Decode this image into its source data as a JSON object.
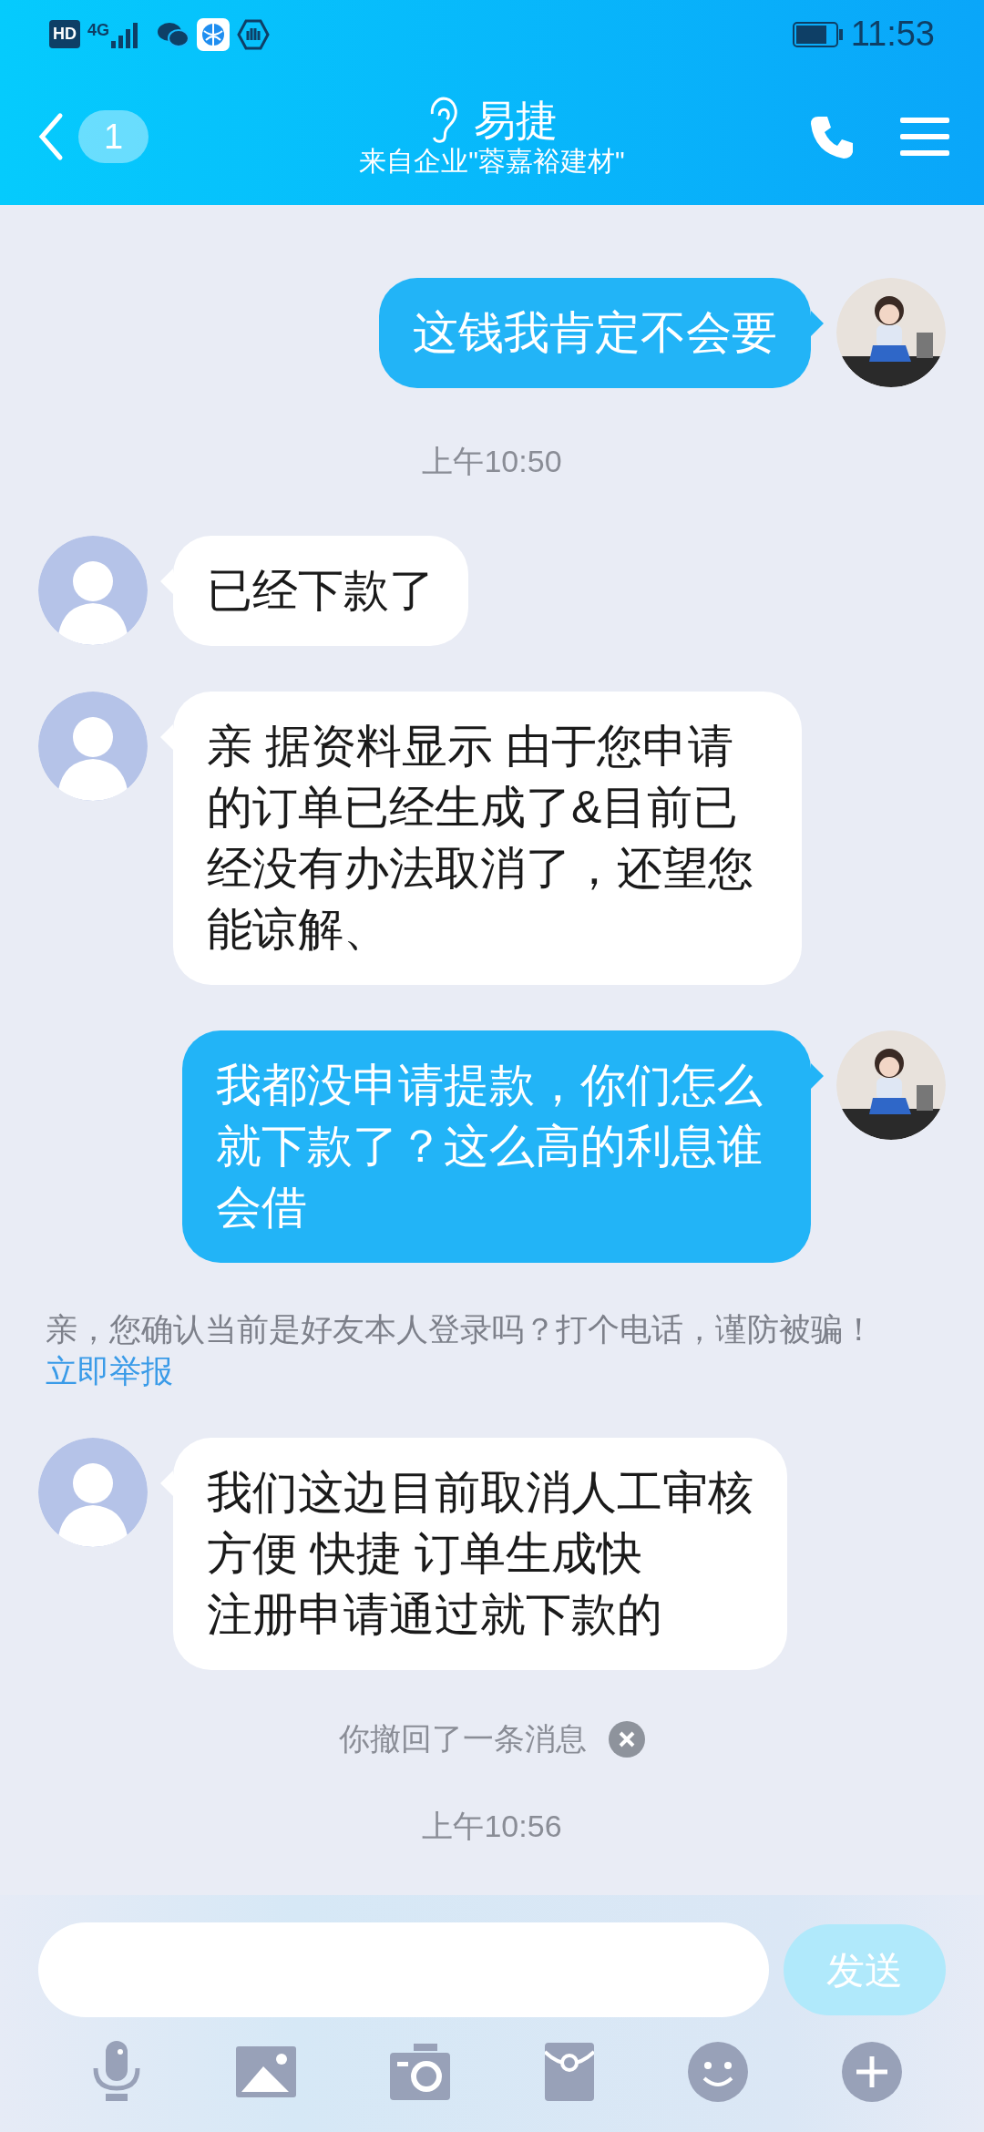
{
  "status_bar": {
    "hd": "HD",
    "network": "4G",
    "time": "11:53"
  },
  "header": {
    "back_count": "1",
    "title": "易捷",
    "subtitle": "来自企业\"蓉嘉裕建材\""
  },
  "messages": [
    {
      "kind": "outgoing",
      "text": "这钱我肯定不会要"
    },
    {
      "kind": "time",
      "text": "上午10:50"
    },
    {
      "kind": "incoming",
      "text": "已经下款了"
    },
    {
      "kind": "incoming",
      "text": "亲 据资料显示 由于您申请的订单已经生成了&目前已经没有办法取消了，还望您能谅解、"
    },
    {
      "kind": "outgoing",
      "text": "我都没申请提款，你们怎么就下款了？这么高的利息谁会借"
    },
    {
      "kind": "warning",
      "text": "亲，您确认当前是好友本人登录吗？打个电话，谨防被骗！",
      "link": "立即举报"
    },
    {
      "kind": "incoming",
      "lines": [
        "我们这边目前取消人工审核",
        "方便 快捷 订单生成快",
        "注册申请通过就下款的"
      ]
    },
    {
      "kind": "recall",
      "text": "你撤回了一条消息"
    },
    {
      "kind": "time",
      "text": "上午10:56"
    }
  ],
  "composer": {
    "send": "发送"
  }
}
